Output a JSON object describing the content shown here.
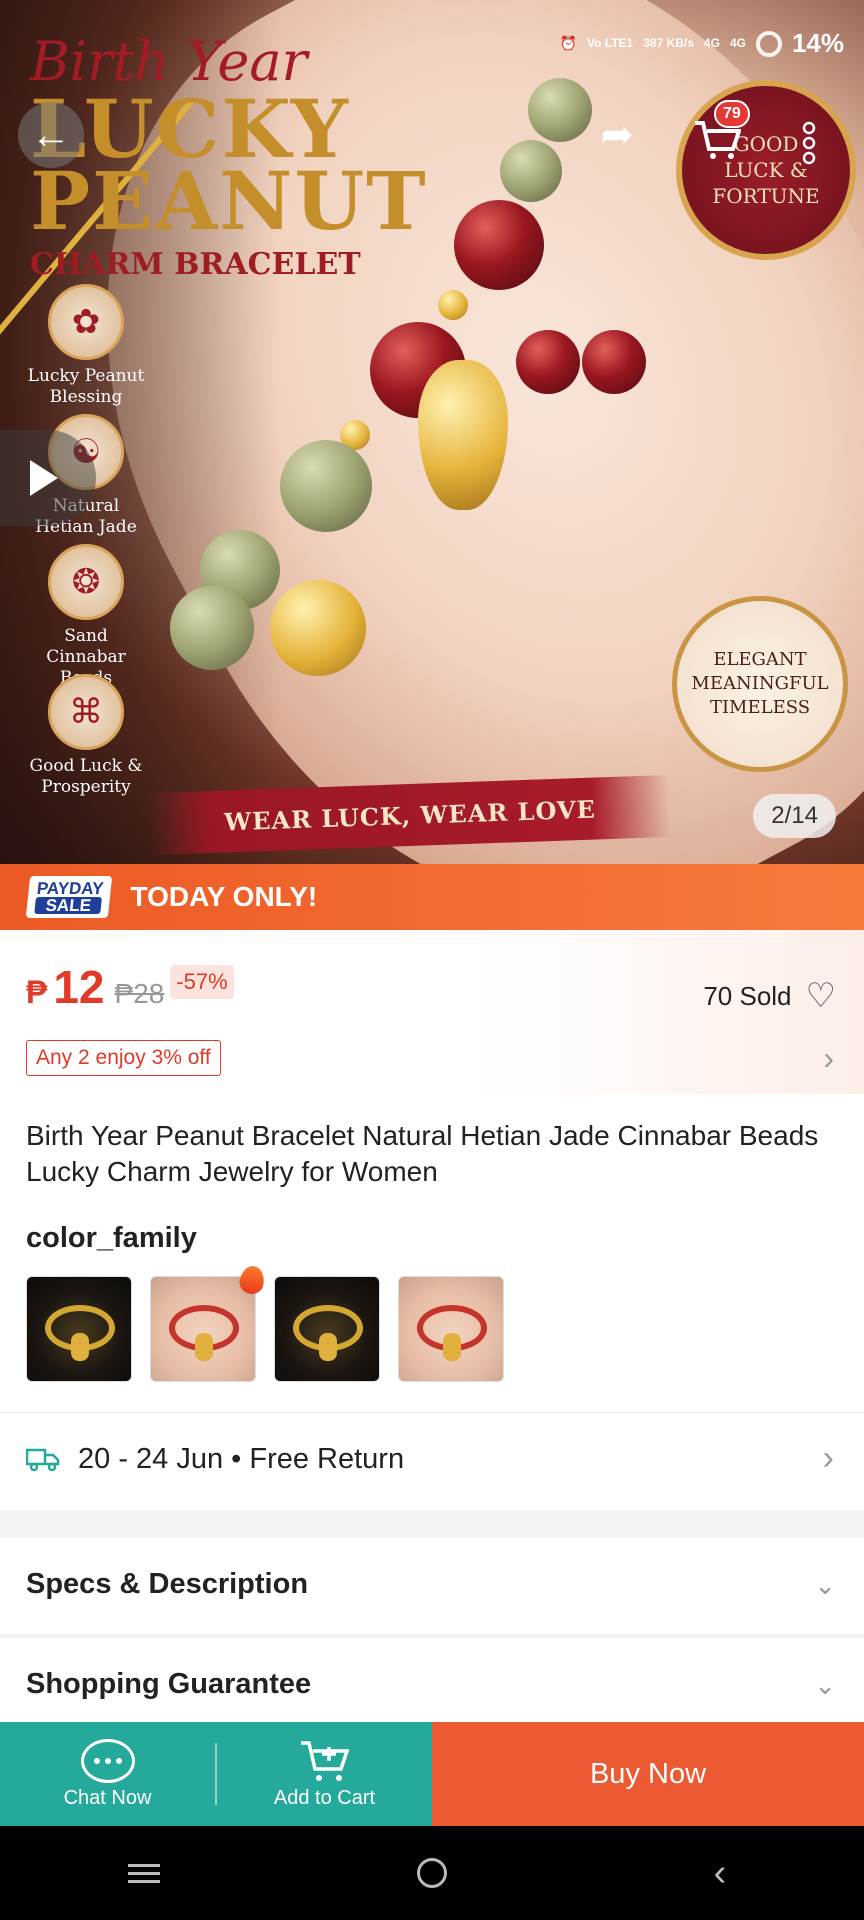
{
  "status_bar": {
    "network": "Vo LTE1",
    "speed": "387 KB/s",
    "signal1": "4G",
    "signal2": "4G",
    "battery": "14%"
  },
  "hero": {
    "script_title": "Birth Year",
    "big_title_line1": "LUCKY",
    "big_title_line2": "PEANUT",
    "subtitle": "CHARM BRACELET",
    "features": [
      {
        "label": "Lucky Peanut Blessing"
      },
      {
        "label": "Natural Hetian Jade"
      },
      {
        "label": "Sand Cinnabar Beads"
      },
      {
        "label": "Good Luck & Prosperity"
      }
    ],
    "seal_text": "GOOD LUCK & FORTUNE",
    "seal2_text": "ELEGANT MEANINGFUL TIMELESS",
    "banner": "WEAR LUCK,  WEAR LOVE",
    "image_counter": "2/14",
    "cart_count": "79"
  },
  "promo_bar": {
    "logo_top": "PAYDAY",
    "logo_bottom": "SALE",
    "label": "TODAY ONLY!"
  },
  "price": {
    "currency": "₱",
    "current": "12",
    "original": "₱28",
    "discount": "-57%",
    "sold": "70 Sold",
    "promo_tag": "Any 2 enjoy 3% off"
  },
  "product": {
    "title": "Birth Year Peanut Bracelet Natural Hetian Jade Cinnabar Beads Lucky Charm Jewelry for Women",
    "variant_label": "color_family"
  },
  "delivery": {
    "text": "20 - 24 Jun • Free Return"
  },
  "sections": {
    "specs": "Specs & Description",
    "guarantee": "Shopping Guarantee"
  },
  "actions": {
    "chat": "Chat Now",
    "add_to_cart": "Add to Cart",
    "buy_now": "Buy Now"
  },
  "colors": {
    "accent": "#e03a28",
    "teal": "#24a99a",
    "buy": "#ec5a33",
    "promo_bar": "#ec5a25"
  }
}
